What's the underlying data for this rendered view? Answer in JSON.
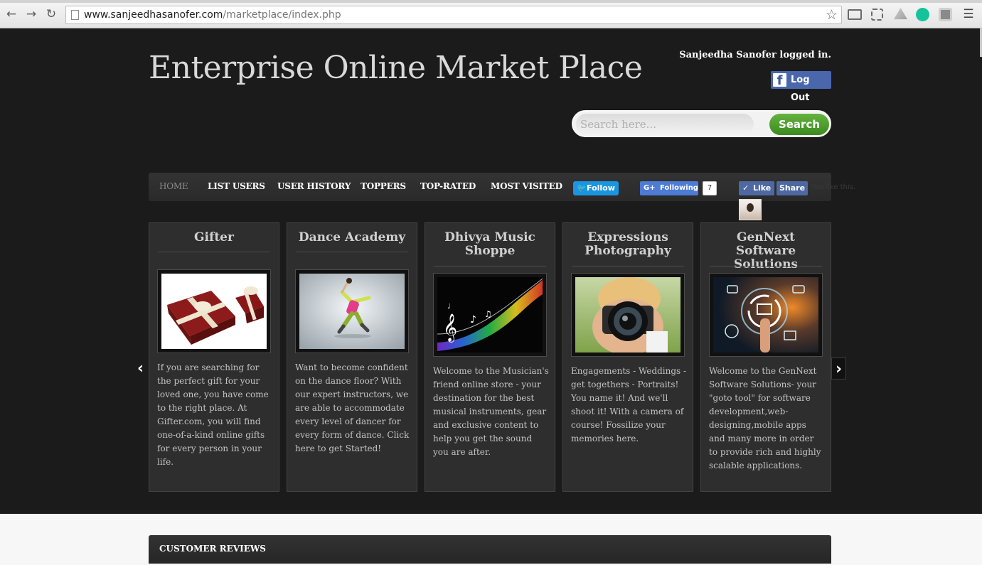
{
  "browser": {
    "url_domain": "www.sanjeedhasanofer.com",
    "url_path": "/marketplace/index.php",
    "back_icon": "back-arrow-icon",
    "forward_icon": "forward-arrow-icon",
    "reload_icon": "reload-icon",
    "back_glyph": "←",
    "forward_glyph": "→",
    "reload_glyph": "↻",
    "star_glyph": "☆",
    "menu_glyph": "☰"
  },
  "header": {
    "site_title": "Enterprise Online Market Place",
    "logged_in_text": "Sanjeedha Sanofer logged in.",
    "logout_label": "Log Out",
    "fb_glyph": "f",
    "search_placeholder": "Search here...",
    "search_button": "Search"
  },
  "nav": {
    "items": [
      "HOME",
      "LIST USERS",
      "USER HISTORY",
      "TOPPERS",
      "TOP-RATED",
      "MOST VISITED"
    ],
    "twitter_label": "Follow",
    "twitter_glyph": "🐦",
    "gplus_glyph": "G+",
    "gplus_label": "Following",
    "gplus_count": "7",
    "fb_like": "Like",
    "fb_check_glyph": "✓",
    "fb_share": "Share",
    "fb_text": "You like this."
  },
  "cards": [
    {
      "title": "Gifter",
      "description": "If you are searching for the perfect gift for your loved one, you have come to the right place. At Gifter.com, you will find one-of-a-kind online gifts for every person in your life."
    },
    {
      "title": "Dance Academy",
      "description": "Want to become confident on the dance floor? With our expert instructors, we are able to accommodate every level of dancer for every form of dance. Click here to get Started!"
    },
    {
      "title": "Dhivya Music Shoppe",
      "description": "Welcome to the Musician's friend online store - your destination for the best musical instruments, gear and exclusive content to help you get the sound you are after."
    },
    {
      "title": "Expressions Photography",
      "description": "Engagements - Weddings - get togethers - Portraits! You name it! And we'll shoot it! With a camera of course! Fossilize your memories here."
    },
    {
      "title": "GenNext Software Solutions",
      "description": "Welcome to the GenNext Software Solutions- your \"goto tool\" for software development,web-designing,mobile apps and many more in order to provide rich and highly scalable applications."
    }
  ],
  "carousel": {
    "prev_glyph": "‹",
    "next_glyph": "›"
  },
  "reviews": {
    "title": "CUSTOMER REVIEWS"
  },
  "colors": {
    "page_bg": "#1b1b1b",
    "search_green": "#4a9a2a",
    "facebook_blue": "#4a66ad",
    "twitter_blue": "#1b95e0",
    "gplus_blue": "#4d7bd6"
  }
}
